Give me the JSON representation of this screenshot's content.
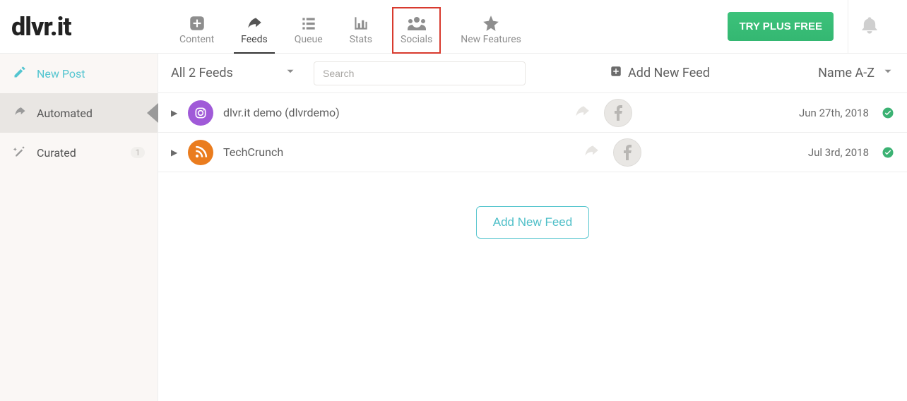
{
  "brand": {
    "name_left": "dlvr",
    "name_dot": ".",
    "name_right": "it"
  },
  "nav": {
    "content": "Content",
    "feeds": "Feeds",
    "queue": "Queue",
    "stats": "Stats",
    "socials": "Socials",
    "new_features": "New Features"
  },
  "cta": {
    "try_plus": "TRY PLUS FREE"
  },
  "sidebar": {
    "new_post": "New Post",
    "automated": "Automated",
    "curated": "Curated",
    "curated_count": "1"
  },
  "toolbar": {
    "all_feeds_label": "All 2 Feeds",
    "search_placeholder": "Search",
    "add_new_feed": "Add New Feed",
    "sort_label": "Name A-Z"
  },
  "feeds": {
    "row0": {
      "name": "dlvr.it demo (dlvrdemo)",
      "date": "Jun 27th, 2018"
    },
    "row1": {
      "name": "TechCrunch",
      "date": "Jul 3rd, 2018"
    }
  },
  "center_button": {
    "add_new_feed": "Add New Feed"
  }
}
